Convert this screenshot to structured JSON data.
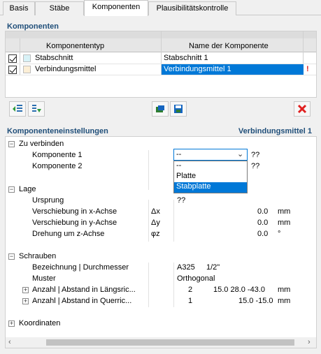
{
  "tabs": [
    "Basis",
    "Stäbe",
    "Komponenten",
    "Plausibilitätskontrolle"
  ],
  "components": {
    "title": "Komponenten",
    "col_type": "Komponententyp",
    "col_name": "Name der Komponente",
    "rows": [
      {
        "type": "Stabschnitt",
        "name": "Stabschnitt 1",
        "swatch": "#d8f2f7"
      },
      {
        "type": "Verbindungsmittel",
        "name": "Verbindungsmittel 1",
        "swatch": "#fcefd6",
        "warning": "!"
      }
    ]
  },
  "settings": {
    "title": "Komponenteneinstellungen",
    "current": "Verbindungsmittel 1",
    "groups": {
      "zu_verbinden": "Zu verbinden",
      "lage": "Lage",
      "schrauben": "Schrauben",
      "koordinaten": "Koordinaten"
    },
    "k1": {
      "label": "Komponente 1",
      "value": "--",
      "extra": "??"
    },
    "k2": {
      "label": "Komponente 2",
      "extra": "??"
    },
    "dropdown_options": [
      "--",
      "Platte",
      "Stabplatte"
    ],
    "ursprung": {
      "label": "Ursprung",
      "value": "??"
    },
    "vx": {
      "label": "Verschiebung in x-Achse",
      "sym": "Δx",
      "value": "0.0",
      "unit": "mm"
    },
    "vy": {
      "label": "Verschiebung in y-Achse",
      "sym": "Δy",
      "value": "0.0",
      "unit": "mm"
    },
    "rz": {
      "label": "Drehung um z-Achse",
      "sym": "φz",
      "value": "0.0",
      "unit": "°"
    },
    "bez": {
      "label": "Bezeichnung | Durchmesser",
      "v1": "A325",
      "v2": "1/2\""
    },
    "muster": {
      "label": "Muster",
      "value": "Orthogonal"
    },
    "al": {
      "label": "Anzahl | Abstand in Längsric...",
      "n": "2",
      "vals": "15.0 28.0 -43.0",
      "unit": "mm"
    },
    "aq": {
      "label": "Anzahl | Abstand in Querric...",
      "n": "1",
      "vals": "15.0 -15.0",
      "unit": "mm"
    }
  },
  "colors": {
    "accent": "#0078d7",
    "title": "#1f4e79",
    "delete": "#e02020"
  }
}
